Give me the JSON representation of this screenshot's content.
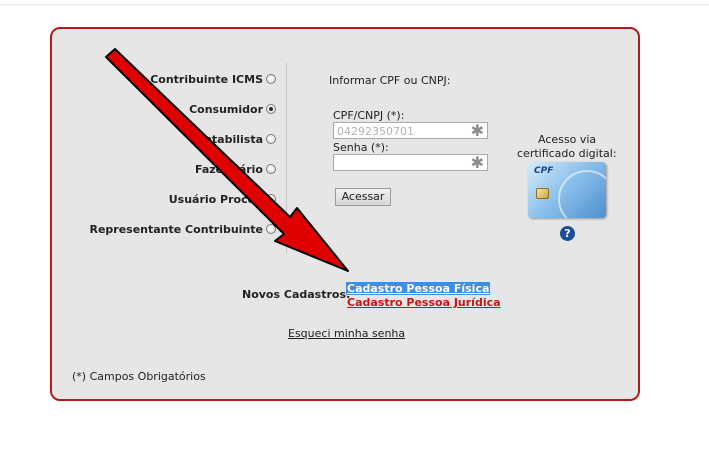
{
  "user_types": [
    {
      "label": "Contribuinte ICMS",
      "checked": false
    },
    {
      "label": "Consumidor",
      "checked": true
    },
    {
      "label": "Contabilista",
      "checked": false
    },
    {
      "label": "Fazendário",
      "checked": false
    },
    {
      "label": "Usuário Procon",
      "checked": false
    },
    {
      "label": "Representante Contribuinte",
      "checked": false
    }
  ],
  "login": {
    "instruction": "Informar CPF ou CNPJ:",
    "cpf_label": "CPF/CNPJ (*):",
    "cpf_value": "04292350701",
    "password_label": "Senha (*):",
    "password_value": "",
    "required_marker": "✱",
    "submit_label": "Acessar"
  },
  "certificate": {
    "caption_line1": "Acesso via",
    "caption_line2": "certificado digital:",
    "card_brand": "CPF",
    "help_icon": "?"
  },
  "registration": {
    "label": "Novos Cadastros:",
    "pessoa_fisica": "Cadastro Pessoa Física",
    "pessoa_juridica": "Cadastro Pessoa Jurídica"
  },
  "forgot_password": "Esqueci minha senha",
  "footnote": "(*) Campos Obrigatórios",
  "colors": {
    "panel_border": "#b31b1b",
    "panel_background": "#e6e6e6",
    "link_highlight": "#3d8ee6",
    "link_red": "#c81414",
    "arrow_fill": "#e10000"
  },
  "overlay": {
    "icon": "red-arrow-annotation-icon"
  }
}
